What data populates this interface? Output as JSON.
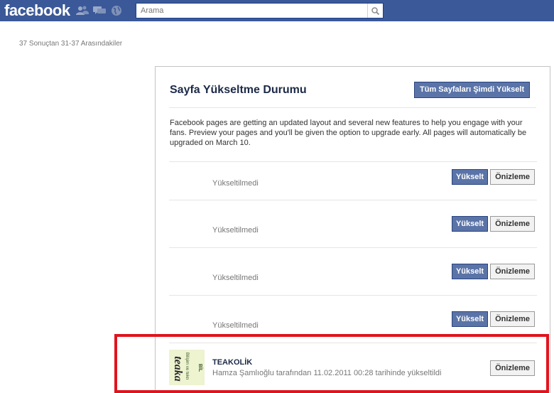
{
  "topbar": {
    "logo": "facebook",
    "search_placeholder": "Arama",
    "icons": [
      "friends-icon",
      "messages-icon",
      "notifications-globe-icon",
      "search-icon"
    ]
  },
  "results_text": "37 Sonuçtan 31-37 Arasındakiler",
  "panel": {
    "title": "Sayfa Yükseltme Durumu",
    "upgrade_all_label": "Tüm Sayfaları Şimdi Yükselt",
    "description": "Facebook pages are getting an updated layout and several new features to help you engage with your fans. Preview your pages and you'll be given the option to upgrade early. All pages will automatically be upgraded on March 10.",
    "rows": [
      {
        "status": "Yükseltilmedi",
        "upgrade_label": "Yükselt",
        "preview_label": "Önizleme"
      },
      {
        "status": "Yükseltilmedi",
        "upgrade_label": "Yükselt",
        "preview_label": "Önizleme"
      },
      {
        "status": "Yükseltilmedi",
        "upgrade_label": "Yükselt",
        "preview_label": "Önizleme"
      },
      {
        "status": "Yükseltilmedi",
        "upgrade_label": "Yükselt",
        "preview_label": "Önizleme"
      }
    ],
    "upgraded_row": {
      "name": "TEAKOLİK",
      "status": "Hamza Şamlıoğlu tarafından 11.02.2011 00:28 tarihinde yükseltildi",
      "preview_label": "Önizleme",
      "thumb_text": "Bilişim ve tekn",
      "thumb_logo": "teaka",
      "thumb_side": "BİL"
    }
  },
  "colors": {
    "brand": "#3b5998",
    "button_blue": "#5b74a8",
    "highlight": "#e0141e"
  }
}
